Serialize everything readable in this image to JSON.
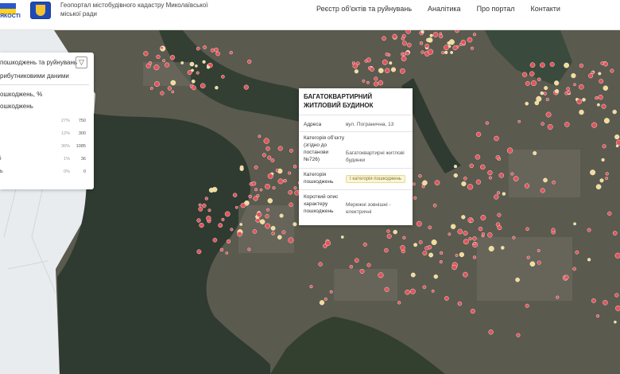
{
  "header": {
    "brand_text": "ЯКОСТІ",
    "portal_title": "Геопортал містобудівного кадастру Миколаївської міської ради",
    "nav": [
      "Реєстр об'єктів та руйнувань",
      "Аналітика",
      "Про портал",
      "Контакти"
    ]
  },
  "panel": {
    "title": "пошкоджень та руйнувань",
    "subtitle": "рибутниковими даними",
    "heading1": "ошкоджень, %",
    "heading2": "ошкоджень",
    "rows": [
      {
        "label": "",
        "pct": "27%",
        "count": "750"
      },
      {
        "label": "",
        "pct": "12%",
        "count": "300"
      },
      {
        "label": "",
        "pct": "36%",
        "count": "1085"
      },
      {
        "label": "і",
        "pct": "1%",
        "count": "36"
      },
      {
        "label": "ь",
        "pct": "0%",
        "count": "0"
      }
    ]
  },
  "popup": {
    "title": "БАГАТОКВАРТИРНИЙ ЖИТЛОВИЙ БУДИНОК",
    "address_label": "Адреса",
    "address_value": "вул. Погранична, 13",
    "category_label": "Категорія об'єкту (згідно до постанови №726)",
    "category_value": "Багатоквартирні житлові будинки",
    "damage_label": "Категорія пошкоджень",
    "damage_value": "I категорія пошкоджень",
    "desc_label": "Короткий опис характеру пошкоджень",
    "desc_value": "Мережні зовнішні - електричні"
  },
  "map": {
    "water_color": "#2f3a30",
    "land_color": "#5b5a4e",
    "marker_red": "#e4545a",
    "marker_yellow": "#f3dc94"
  }
}
